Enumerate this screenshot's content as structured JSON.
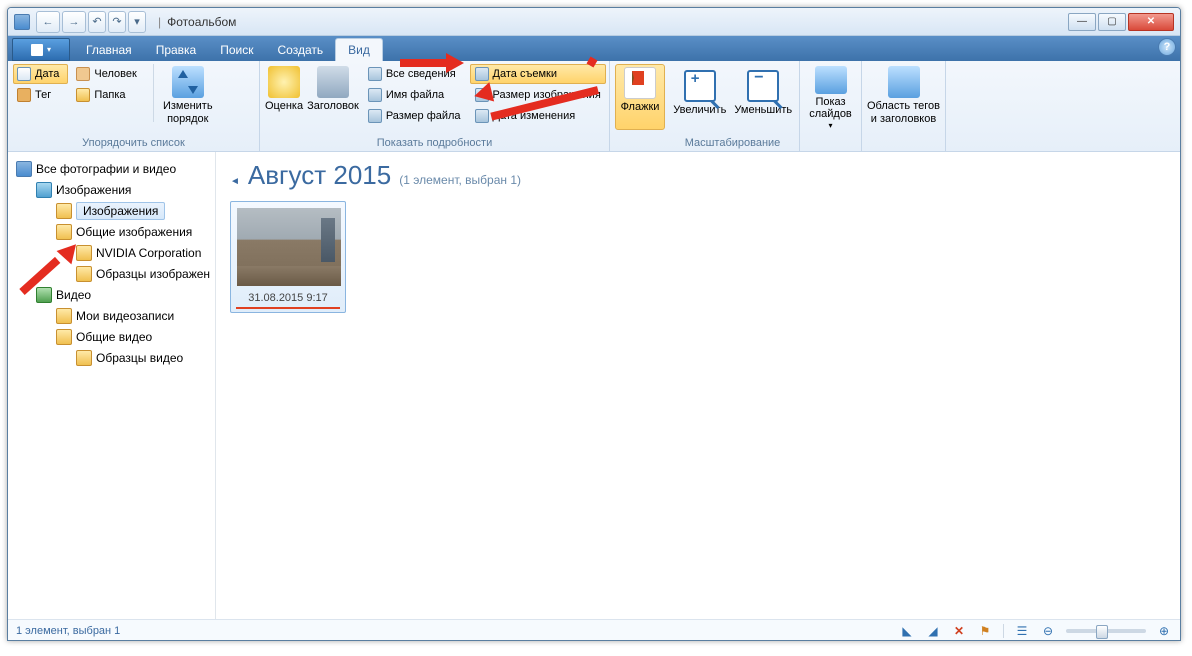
{
  "window": {
    "title": "Фотоальбом"
  },
  "tabs": {
    "main": "Главная",
    "edit": "Правка",
    "search": "Поиск",
    "create": "Создать",
    "view": "Вид"
  },
  "ribbon": {
    "arrange": {
      "label": "Упорядочить список",
      "date": "Дата",
      "tag": "Тег",
      "person": "Человек",
      "folder": "Папка",
      "reverse": "Изменить порядок"
    },
    "details": {
      "label": "Показать подробности",
      "rating": "Оценка",
      "caption": "Заголовок",
      "all_info": "Все сведения",
      "filename": "Имя файла",
      "filesize": "Размер файла",
      "date_taken": "Дата съемки",
      "image_size": "Размер изображения",
      "date_modified": "Дата изменения"
    },
    "flags": {
      "label": "Флажки"
    },
    "zoom": {
      "label": "Масштабирование",
      "in": "Увеличить",
      "out": "Уменьшить"
    },
    "slideshow": {
      "label": "Показ слайдов"
    },
    "tagarea": {
      "label": "Область тегов и заголовков"
    }
  },
  "tree": {
    "all": "Все фотографии и видео",
    "images": "Изображения",
    "images_sub": "Изображения",
    "public_images": "Общие изображения",
    "nvidia": "NVIDIA Corporation",
    "samples_img": "Образцы изображен",
    "video": "Видео",
    "my_video": "Мои видеозаписи",
    "public_video": "Общие видео",
    "samples_video": "Образцы видео"
  },
  "content": {
    "group_title": "Август 2015",
    "group_sub": "(1 элемент, выбран 1)",
    "thumb_caption": "31.08.2015 9:17"
  },
  "status": {
    "text": "1 элемент, выбран 1"
  }
}
